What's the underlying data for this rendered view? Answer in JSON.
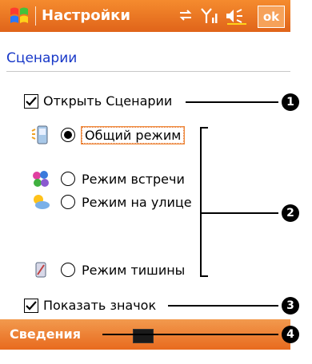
{
  "titlebar": {
    "title": "Настройки",
    "ok_label": "ok",
    "icons": [
      "start-icon",
      "connectivity-icon",
      "signal-icon",
      "volume-icon"
    ]
  },
  "section_title": "Сценарии",
  "open_profiles": {
    "label": "Открыть Сценарии",
    "checked": true
  },
  "profiles": [
    {
      "label": "Общий режим",
      "selected": true,
      "icon": "phone-icon"
    },
    {
      "label": "Режим встречи",
      "selected": false,
      "icon": "meeting-icon"
    },
    {
      "label": "Режим на улице",
      "selected": false,
      "icon": "outdoor-icon"
    },
    {
      "label": "Режим тишины",
      "selected": false,
      "icon": "silent-icon"
    }
  ],
  "show_icon": {
    "label": "Показать значок",
    "checked": true
  },
  "bottombar": {
    "softkey_label": "Сведения",
    "keyboard_icon": "keyboard-icon"
  },
  "callouts": [
    "1",
    "2",
    "3",
    "4"
  ],
  "colors": {
    "bar": "#e8741f",
    "section": "#1838c8"
  }
}
